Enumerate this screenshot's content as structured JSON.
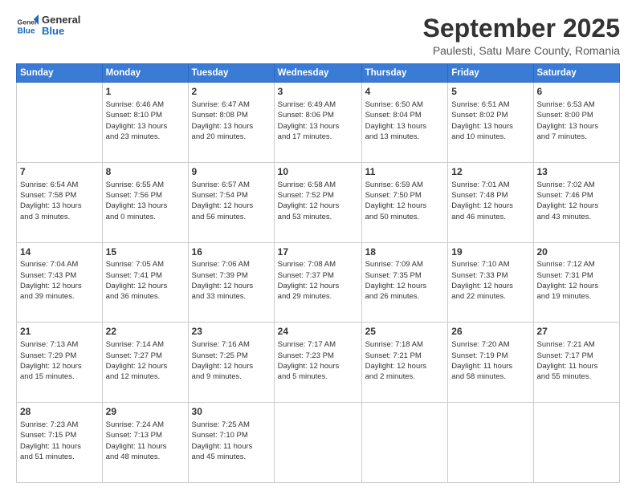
{
  "header": {
    "logo": {
      "line1": "General",
      "line2": "Blue"
    },
    "title": "September 2025",
    "subtitle": "Paulesti, Satu Mare County, Romania"
  },
  "days_of_week": [
    "Sunday",
    "Monday",
    "Tuesday",
    "Wednesday",
    "Thursday",
    "Friday",
    "Saturday"
  ],
  "weeks": [
    [
      {
        "day": "",
        "info": ""
      },
      {
        "day": "1",
        "info": "Sunrise: 6:46 AM\nSunset: 8:10 PM\nDaylight: 13 hours\nand 23 minutes."
      },
      {
        "day": "2",
        "info": "Sunrise: 6:47 AM\nSunset: 8:08 PM\nDaylight: 13 hours\nand 20 minutes."
      },
      {
        "day": "3",
        "info": "Sunrise: 6:49 AM\nSunset: 8:06 PM\nDaylight: 13 hours\nand 17 minutes."
      },
      {
        "day": "4",
        "info": "Sunrise: 6:50 AM\nSunset: 8:04 PM\nDaylight: 13 hours\nand 13 minutes."
      },
      {
        "day": "5",
        "info": "Sunrise: 6:51 AM\nSunset: 8:02 PM\nDaylight: 13 hours\nand 10 minutes."
      },
      {
        "day": "6",
        "info": "Sunrise: 6:53 AM\nSunset: 8:00 PM\nDaylight: 13 hours\nand 7 minutes."
      }
    ],
    [
      {
        "day": "7",
        "info": "Sunrise: 6:54 AM\nSunset: 7:58 PM\nDaylight: 13 hours\nand 3 minutes."
      },
      {
        "day": "8",
        "info": "Sunrise: 6:55 AM\nSunset: 7:56 PM\nDaylight: 13 hours\nand 0 minutes."
      },
      {
        "day": "9",
        "info": "Sunrise: 6:57 AM\nSunset: 7:54 PM\nDaylight: 12 hours\nand 56 minutes."
      },
      {
        "day": "10",
        "info": "Sunrise: 6:58 AM\nSunset: 7:52 PM\nDaylight: 12 hours\nand 53 minutes."
      },
      {
        "day": "11",
        "info": "Sunrise: 6:59 AM\nSunset: 7:50 PM\nDaylight: 12 hours\nand 50 minutes."
      },
      {
        "day": "12",
        "info": "Sunrise: 7:01 AM\nSunset: 7:48 PM\nDaylight: 12 hours\nand 46 minutes."
      },
      {
        "day": "13",
        "info": "Sunrise: 7:02 AM\nSunset: 7:46 PM\nDaylight: 12 hours\nand 43 minutes."
      }
    ],
    [
      {
        "day": "14",
        "info": "Sunrise: 7:04 AM\nSunset: 7:43 PM\nDaylight: 12 hours\nand 39 minutes."
      },
      {
        "day": "15",
        "info": "Sunrise: 7:05 AM\nSunset: 7:41 PM\nDaylight: 12 hours\nand 36 minutes."
      },
      {
        "day": "16",
        "info": "Sunrise: 7:06 AM\nSunset: 7:39 PM\nDaylight: 12 hours\nand 33 minutes."
      },
      {
        "day": "17",
        "info": "Sunrise: 7:08 AM\nSunset: 7:37 PM\nDaylight: 12 hours\nand 29 minutes."
      },
      {
        "day": "18",
        "info": "Sunrise: 7:09 AM\nSunset: 7:35 PM\nDaylight: 12 hours\nand 26 minutes."
      },
      {
        "day": "19",
        "info": "Sunrise: 7:10 AM\nSunset: 7:33 PM\nDaylight: 12 hours\nand 22 minutes."
      },
      {
        "day": "20",
        "info": "Sunrise: 7:12 AM\nSunset: 7:31 PM\nDaylight: 12 hours\nand 19 minutes."
      }
    ],
    [
      {
        "day": "21",
        "info": "Sunrise: 7:13 AM\nSunset: 7:29 PM\nDaylight: 12 hours\nand 15 minutes."
      },
      {
        "day": "22",
        "info": "Sunrise: 7:14 AM\nSunset: 7:27 PM\nDaylight: 12 hours\nand 12 minutes."
      },
      {
        "day": "23",
        "info": "Sunrise: 7:16 AM\nSunset: 7:25 PM\nDaylight: 12 hours\nand 9 minutes."
      },
      {
        "day": "24",
        "info": "Sunrise: 7:17 AM\nSunset: 7:23 PM\nDaylight: 12 hours\nand 5 minutes."
      },
      {
        "day": "25",
        "info": "Sunrise: 7:18 AM\nSunset: 7:21 PM\nDaylight: 12 hours\nand 2 minutes."
      },
      {
        "day": "26",
        "info": "Sunrise: 7:20 AM\nSunset: 7:19 PM\nDaylight: 11 hours\nand 58 minutes."
      },
      {
        "day": "27",
        "info": "Sunrise: 7:21 AM\nSunset: 7:17 PM\nDaylight: 11 hours\nand 55 minutes."
      }
    ],
    [
      {
        "day": "28",
        "info": "Sunrise: 7:23 AM\nSunset: 7:15 PM\nDaylight: 11 hours\nand 51 minutes."
      },
      {
        "day": "29",
        "info": "Sunrise: 7:24 AM\nSunset: 7:13 PM\nDaylight: 11 hours\nand 48 minutes."
      },
      {
        "day": "30",
        "info": "Sunrise: 7:25 AM\nSunset: 7:10 PM\nDaylight: 11 hours\nand 45 minutes."
      },
      {
        "day": "",
        "info": ""
      },
      {
        "day": "",
        "info": ""
      },
      {
        "day": "",
        "info": ""
      },
      {
        "day": "",
        "info": ""
      }
    ]
  ]
}
